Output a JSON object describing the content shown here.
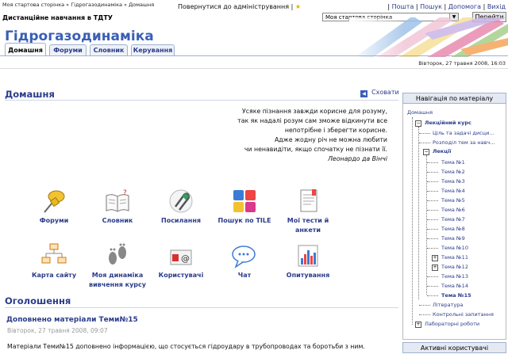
{
  "topbar": {
    "breadcrumb": "Моя стартова сторінка » Гідрогазодинаміка » Домашня",
    "return_admin": "Повернутися до адміністрування |",
    "links": [
      "Пошта",
      "Пошук",
      "Допомога",
      "Вихід"
    ],
    "site_name": "Дистанційне навчання в ТДТУ",
    "site_select": "Моя стартова сторінка",
    "go_button": "Перейти"
  },
  "course_title": "Гідрогазодинаміка",
  "tabs": [
    "Домашня",
    "Форуми",
    "Словник",
    "Керування"
  ],
  "date": "Вівторок, 27 травня 2008, 16:03",
  "home": {
    "heading": "Домашня",
    "hide_label": "Сховати",
    "quote": [
      "Усяке пізнання завжди корисне для розуму,",
      "так як надалі розум сам зможе відкинути все",
      "непотрібне і зберегти корисне.",
      "Адже жодну річ не можна любити",
      "чи ненавидіти, якщо спочатку не пізнати її."
    ],
    "quote_author": "Леонардо да Вінчі"
  },
  "icons": [
    {
      "name": "pushpin-icon",
      "label1": "Форуми",
      "label2": ""
    },
    {
      "name": "book-icon",
      "label1": "Словник",
      "label2": ""
    },
    {
      "name": "paperclip-icon",
      "label1": "Посилання",
      "label2": ""
    },
    {
      "name": "blocks-icon",
      "label1": "Пошук по TILE",
      "label2": ""
    },
    {
      "name": "document-icon",
      "label1": "Мої тести й",
      "label2": "анкети"
    },
    {
      "name": "sitemap-icon",
      "label1": "Карта сайту",
      "label2": ""
    },
    {
      "name": "footprints-icon",
      "label1": "Моя динаміка",
      "label2": "вивчення курсу"
    },
    {
      "name": "users-icon",
      "label1": "Користувачі",
      "label2": ""
    },
    {
      "name": "chat-icon",
      "label1": "Чат",
      "label2": ""
    },
    {
      "name": "chart-icon",
      "label1": "Опитування",
      "label2": ""
    }
  ],
  "announcements": {
    "heading": "Оголошення",
    "post_title": "Доповнено матеріали Теми№15",
    "post_date": "Вівторок, 27 травня 2008, 09:07",
    "post_body": "Матеріали Теми№15 доповнено інформацією, що стосується гідроудару в трубопроводах та боротьби з ним."
  },
  "nav": {
    "heading": "Навігація по матеріалу",
    "home": "Домашня",
    "lecture_course": "Лекційний курс",
    "goal": "Ціль та задачі дисци...",
    "topics_dist": "Розподіл тем за навч...",
    "lectures": "Лекції",
    "topics": [
      "Тема №1",
      "Тема №2",
      "Тема №3",
      "Тема №4",
      "Тема №5",
      "Тема №6",
      "Тема №7",
      "Тема №8",
      "Тема №9",
      "Тема №10",
      "Тема №11",
      "Тема №12",
      "Тема №13",
      "Тема №14",
      "Тема №15"
    ],
    "literature": "Література",
    "control": "Контрольні запитання",
    "labs": "Лабораторні роботи"
  },
  "active_users_heading": "Активні користувачі",
  "colors": {
    "accent": "#2b3c8a",
    "title": "#3a5fb5"
  }
}
